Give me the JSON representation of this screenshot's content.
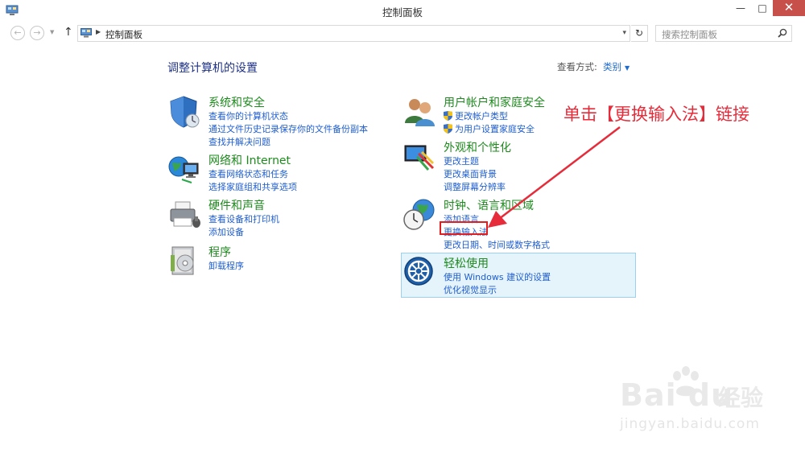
{
  "window": {
    "title": "控制面板",
    "minimize": "—",
    "maximize": "□",
    "close": "✕"
  },
  "navigation": {
    "back": "←",
    "forward": "→",
    "up": "↑",
    "breadcrumb": "控制面板",
    "refresh": "↻",
    "search_placeholder": "搜索控制面板"
  },
  "main": {
    "title": "调整计算机的设置",
    "view_by_label": "查看方式:",
    "view_by_value": "类别",
    "categories": [
      {
        "heading": "系统和安全",
        "links": [
          "查看你的计算机状态",
          "通过文件历史记录保存你的文件备份副本",
          "查找并解决问题"
        ]
      },
      {
        "heading": "网络和 Internet",
        "links": [
          "查看网络状态和任务",
          "选择家庭组和共享选项"
        ]
      },
      {
        "heading": "硬件和声音",
        "links": [
          "查看设备和打印机",
          "添加设备"
        ]
      },
      {
        "heading": "程序",
        "links": [
          "卸载程序"
        ]
      },
      {
        "heading": "用户帐户和家庭安全",
        "links": [
          "更改帐户类型",
          "为用户设置家庭安全"
        ]
      },
      {
        "heading": "外观和个性化",
        "links": [
          "更改主题",
          "更改桌面背景",
          "调整屏幕分辨率"
        ]
      },
      {
        "heading": "时钟、语言和区域",
        "links": [
          "添加语言",
          "更换输入法",
          "更改日期、时间或数字格式"
        ]
      },
      {
        "heading": "轻松使用",
        "links": [
          "使用 Windows 建议的设置",
          "优化视觉显示"
        ]
      }
    ]
  },
  "annotation": {
    "text": "单击【更换输入法】链接",
    "color": "#e62c3a"
  },
  "watermark": {
    "logo": "Bai du",
    "chinese": "经验",
    "url": "jingyan.baidu.com"
  }
}
